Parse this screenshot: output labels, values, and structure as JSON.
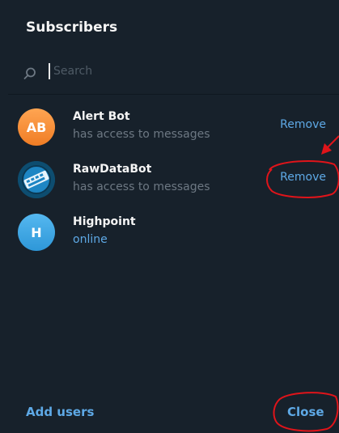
{
  "dialog": {
    "title": "Subscribers",
    "search_placeholder": "Search",
    "add_users_label": "Add users",
    "close_label": "Close"
  },
  "subscribers": [
    {
      "name": "Alert Bot",
      "status": "has access to messages",
      "avatar_text": "AB",
      "action": "Remove"
    },
    {
      "name": "RawDataBot",
      "status": "has access to messages",
      "avatar_text": "",
      "action": "Remove"
    },
    {
      "name": "Highpoint",
      "status": "online",
      "avatar_text": "H",
      "action": ""
    }
  ],
  "colors": {
    "background": "#17212b",
    "accent": "#5ea9e6",
    "annotation": "#e0141a"
  },
  "icons": [
    "search-icon",
    "bot-icon"
  ]
}
